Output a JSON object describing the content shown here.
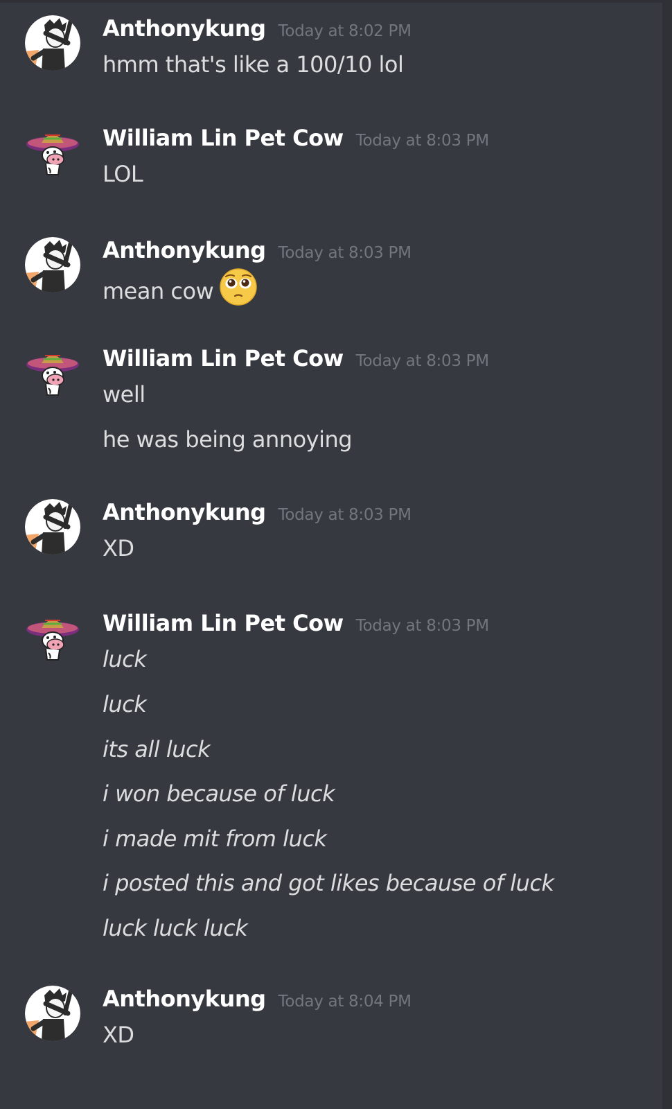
{
  "colors": {
    "background": "#36393f",
    "author": "#ffffff",
    "text": "#dcddde",
    "timestamp": "#72767d"
  },
  "messages": [
    {
      "author": "Anthonykung",
      "avatar": "dabbing-boy-avatar",
      "timestamp": "Today at 8:02 PM",
      "lines": [
        "hmm that's like a 100/10 lol"
      ]
    },
    {
      "author": "William Lin Pet Cow",
      "avatar": "sombrero-cow-avatar",
      "timestamp": "Today at 8:03 PM",
      "lines": [
        "LOL"
      ]
    },
    {
      "author": "Anthonykung",
      "avatar": "dabbing-boy-avatar",
      "timestamp": "Today at 8:03 PM",
      "lines": [
        "mean cow"
      ],
      "emoji": "pleading-face-emoji"
    },
    {
      "author": "William Lin Pet Cow",
      "avatar": "sombrero-cow-avatar",
      "timestamp": "Today at 8:03 PM",
      "lines": [
        "well",
        "he was being annoying"
      ]
    },
    {
      "author": "Anthonykung",
      "avatar": "dabbing-boy-avatar",
      "timestamp": "Today at 8:03 PM",
      "lines": [
        "XD"
      ]
    },
    {
      "author": "William Lin Pet Cow",
      "avatar": "sombrero-cow-avatar",
      "timestamp": "Today at 8:03 PM",
      "lines": [
        "luck",
        "luck",
        "its all luck",
        "i won because of luck",
        "i made mit from luck",
        "i posted this and got likes because of luck",
        "luck luck luck"
      ]
    },
    {
      "author": "Anthonykung",
      "avatar": "dabbing-boy-avatar",
      "timestamp": "Today at 8:04 PM",
      "lines": [
        "XD"
      ]
    }
  ]
}
